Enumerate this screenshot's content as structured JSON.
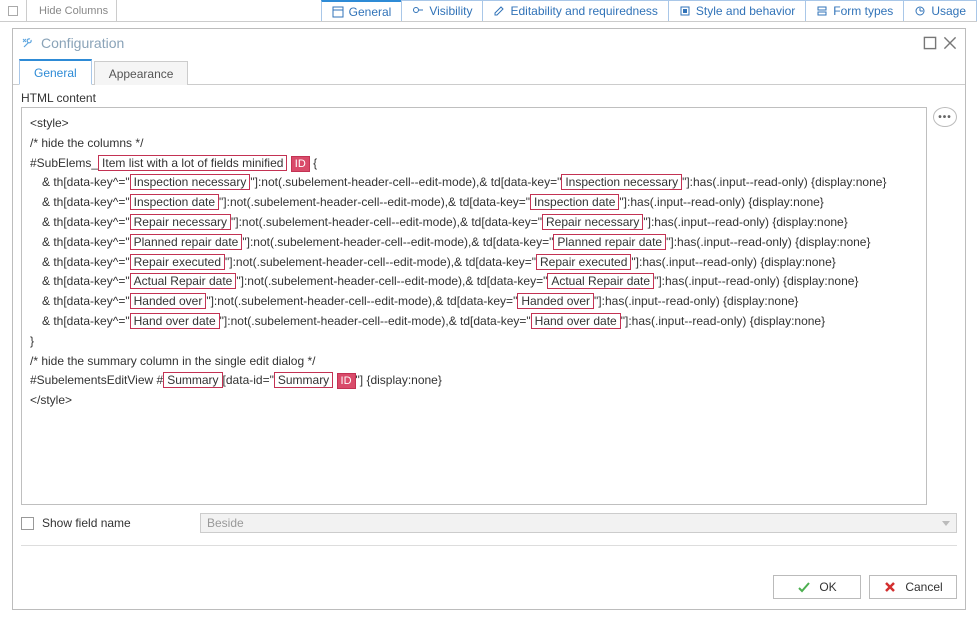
{
  "topbar": {
    "hide_columns": "Hide Columns",
    "tabs": [
      {
        "label": "General",
        "icon": "window-icon"
      },
      {
        "label": "Visibility",
        "icon": "visibility-icon"
      },
      {
        "label": "Editability and requiredness",
        "icon": "edit-icon"
      },
      {
        "label": "Style and behavior",
        "icon": "style-icon"
      },
      {
        "label": "Form types",
        "icon": "form-icon"
      },
      {
        "label": "Usage",
        "icon": "usage-icon"
      }
    ]
  },
  "dialog": {
    "title": "Configuration",
    "tabs": {
      "general": "General",
      "appearance": "Appearance"
    },
    "html_content_label": "HTML content",
    "show_field_name": "Show field name",
    "beside": "Beside",
    "ok": "OK",
    "cancel": "Cancel"
  },
  "code": {
    "open_style": "<style>",
    "comment_hide_cols": "/* hide the columns */",
    "selector_prefix": "#SubElems_",
    "item_list_hl": "Item list with a lot of fields minified",
    "id_badge": "ID",
    "brace_open": " {",
    "rule_prefix1": "& th[data-key^=\"",
    "rule_mid": "\"]:not(.subelement-header-cell--edit-mode),& td[data-key=\"",
    "rule_suffix": "\"]:has(.input--read-only) {display:none}",
    "fields": [
      "Inspection necessary",
      "Inspection date",
      "Repair necessary",
      "Planned repair date",
      "Repair executed",
      "Actual Repair date",
      "Handed over",
      "Hand over date"
    ],
    "brace_close": "}",
    "comment_hide_summary": "/* hide the summary column in the single edit dialog */",
    "summary_prefix": "#SubelementsEditView #",
    "summary_hl": "Summary",
    "summary_mid": "[data-id=\"",
    "summary_suffix": "\"] {display:none}",
    "close_style": "</style>"
  }
}
